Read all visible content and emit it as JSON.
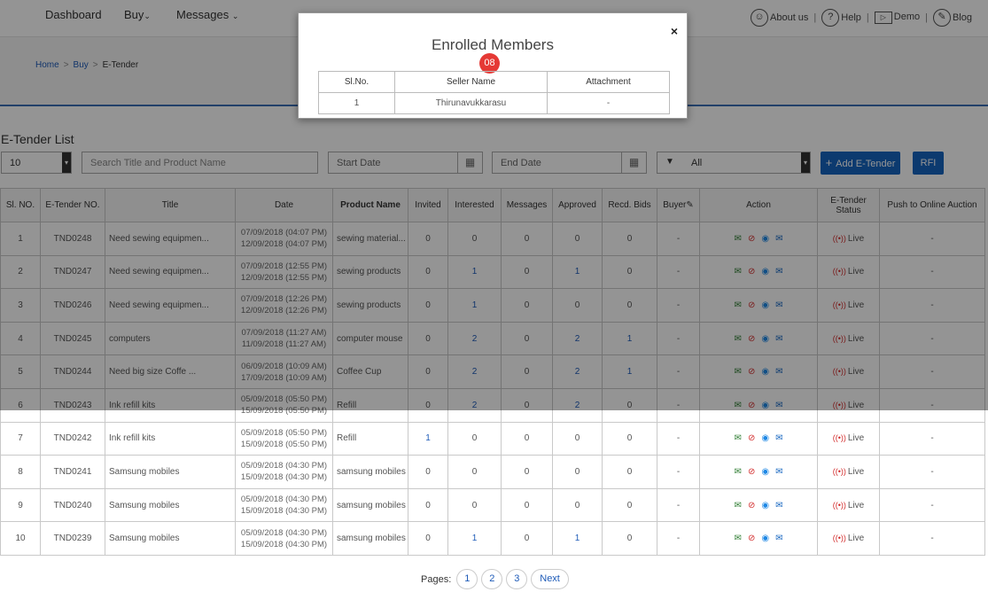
{
  "nav": {
    "dashboard": "Dashboard",
    "buy": "Buy",
    "messages": "Messages",
    "about": "About us",
    "help": "Help",
    "demo": "Demo",
    "blog": "Blog"
  },
  "breadcrumb": {
    "home": "Home",
    "buy": "Buy",
    "current": "E-Tender"
  },
  "list_title": "E-Tender List",
  "toolbar": {
    "page_size": "10",
    "search_placeholder": "Search Title and Product Name",
    "start_date_placeholder": "Start Date",
    "end_date_placeholder": "End Date",
    "filter_value": "All",
    "add_label": "Add E-Tender",
    "rfi_label": "RFI"
  },
  "table": {
    "headers": [
      "Sl. NO.",
      "E-Tender NO.",
      "Title",
      "Date",
      "Product Name",
      "Invited",
      "Interested",
      "Messages",
      "Approved",
      "Recd. Bids",
      "Buyer",
      "Action",
      "E-Tender Status",
      "Push to Online Auction"
    ],
    "rows": [
      {
        "sl": "1",
        "no": "TND0248",
        "title": "Need sewing equipmen...",
        "d1": "07/09/2018 (04:07 PM)",
        "d2": "12/09/2018 (04:07 PM)",
        "product": "sewing material...",
        "invited": "0",
        "interested": "0",
        "messages": "0",
        "approved": "0",
        "bids": "0",
        "buyer": "-",
        "status": "Live",
        "push": "-"
      },
      {
        "sl": "2",
        "no": "TND0247",
        "title": "Need sewing equipmen...",
        "d1": "07/09/2018 (12:55 PM)",
        "d2": "12/09/2018 (12:55 PM)",
        "product": "sewing products",
        "invited": "0",
        "interested": "1",
        "messages": "0",
        "approved": "1",
        "bids": "0",
        "buyer": "-",
        "status": "Live",
        "push": "-"
      },
      {
        "sl": "3",
        "no": "TND0246",
        "title": "Need sewing equipmen...",
        "d1": "07/09/2018 (12:26 PM)",
        "d2": "12/09/2018 (12:26 PM)",
        "product": "sewing products",
        "invited": "0",
        "interested": "1",
        "messages": "0",
        "approved": "0",
        "bids": "0",
        "buyer": "-",
        "status": "Live",
        "push": "-"
      },
      {
        "sl": "4",
        "no": "TND0245",
        "title": "computers",
        "d1": "07/09/2018 (11:27 AM)",
        "d2": "11/09/2018 (11:27 AM)",
        "product": "computer mouse",
        "invited": "0",
        "interested": "2",
        "messages": "0",
        "approved": "2",
        "bids": "1",
        "buyer": "-",
        "status": "Live",
        "push": "-"
      },
      {
        "sl": "5",
        "no": "TND0244",
        "title": "Need big size Coffe ...",
        "d1": "06/09/2018 (10:09 AM)",
        "d2": "17/09/2018 (10:09 AM)",
        "product": "Coffee Cup",
        "invited": "0",
        "interested": "2",
        "messages": "0",
        "approved": "2",
        "bids": "1",
        "buyer": "-",
        "status": "Live",
        "push": "-"
      },
      {
        "sl": "6",
        "no": "TND0243",
        "title": "Ink refill kits",
        "d1": "05/09/2018 (05:50 PM)",
        "d2": "15/09/2018 (05:50 PM)",
        "product": "Refill",
        "invited": "0",
        "interested": "2",
        "messages": "0",
        "approved": "2",
        "bids": "0",
        "buyer": "-",
        "status": "Live",
        "push": "-"
      },
      {
        "sl": "7",
        "no": "TND0242",
        "title": "Ink refill kits",
        "d1": "05/09/2018 (05:50 PM)",
        "d2": "15/09/2018 (05:50 PM)",
        "product": "Refill",
        "invited": "1",
        "interested": "0",
        "messages": "0",
        "approved": "0",
        "bids": "0",
        "buyer": "-",
        "status": "Live",
        "push": "-"
      },
      {
        "sl": "8",
        "no": "TND0241",
        "title": "Samsung mobiles",
        "d1": "05/09/2018 (04:30 PM)",
        "d2": "15/09/2018 (04:30 PM)",
        "product": "samsung mobiles",
        "invited": "0",
        "interested": "0",
        "messages": "0",
        "approved": "0",
        "bids": "0",
        "buyer": "-",
        "status": "Live",
        "push": "-"
      },
      {
        "sl": "9",
        "no": "TND0240",
        "title": "Samsung mobiles",
        "d1": "05/09/2018 (04:30 PM)",
        "d2": "15/09/2018 (04:30 PM)",
        "product": "samsung mobiles",
        "invited": "0",
        "interested": "0",
        "messages": "0",
        "approved": "0",
        "bids": "0",
        "buyer": "-",
        "status": "Live",
        "push": "-"
      },
      {
        "sl": "10",
        "no": "TND0239",
        "title": "Samsung mobiles",
        "d1": "05/09/2018 (04:30 PM)",
        "d2": "15/09/2018 (04:30 PM)",
        "product": "samsung mobiles",
        "invited": "0",
        "interested": "1",
        "messages": "0",
        "approved": "1",
        "bids": "0",
        "buyer": "-",
        "status": "Live",
        "push": "-"
      }
    ]
  },
  "pager": {
    "label": "Pages:",
    "pages": [
      "1",
      "2",
      "3"
    ],
    "next": "Next"
  },
  "modal": {
    "title": "Enrolled Members",
    "badge": "08",
    "close": "×",
    "headers": [
      "Sl.No.",
      "Seller Name",
      "Attachment"
    ],
    "rows": [
      {
        "sl": "1",
        "name": "Thirunavukkarasu",
        "attachment": "-"
      }
    ]
  },
  "icons": [
    "user-circle-icon",
    "question-circle-icon",
    "demo-icon",
    "blog-icon",
    "calendar-icon",
    "filter-icon",
    "plus-icon",
    "envelope-icon",
    "stop-icon",
    "eye-icon",
    "open-envelope-icon",
    "live-signal-icon",
    "clip-icon"
  ],
  "colors": {
    "primary": "#1565c0",
    "link": "#1e5bb8",
    "danger": "#d32f2f",
    "success": "#2e7d32",
    "badge": "#e53935"
  }
}
